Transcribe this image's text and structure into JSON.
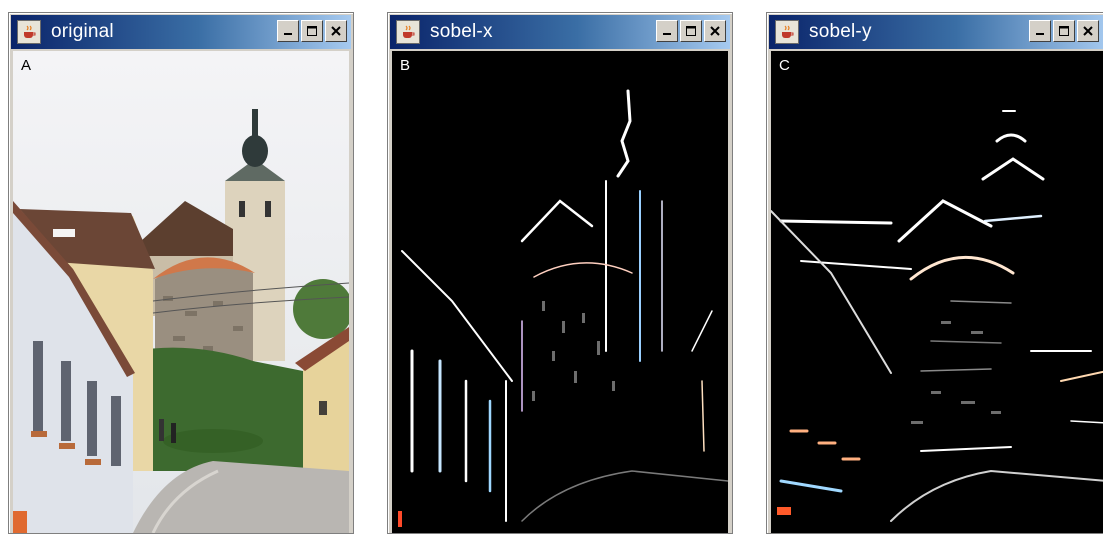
{
  "windows": [
    {
      "title": "original",
      "label": "A"
    },
    {
      "title": "sobel-x",
      "label": "B"
    },
    {
      "title": "sobel-y",
      "label": "C"
    }
  ],
  "icons": {
    "app": "java-cup-icon",
    "minimize": "minimize-icon",
    "maximize": "maximize-icon",
    "close": "close-icon"
  }
}
